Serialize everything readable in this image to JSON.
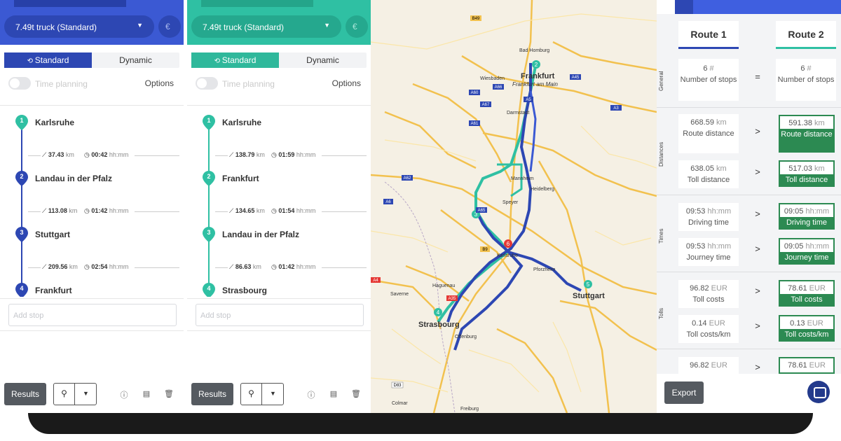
{
  "panels": [
    {
      "vehicle": "7.49t truck (Standard)",
      "currency": "€",
      "mode_tabs": [
        "Standard",
        "Dynamic"
      ],
      "time_planning": "Time planning",
      "options": "Options",
      "stops": [
        {
          "index": "1",
          "name": "Karlsruhe"
        },
        {
          "index": "2",
          "name": "Landau in der Pfalz"
        },
        {
          "index": "3",
          "name": "Stuttgart"
        },
        {
          "index": "4",
          "name": "Frankfurt"
        }
      ],
      "legs": [
        {
          "distance": "37.43",
          "dist_unit": "km",
          "time": "00:42",
          "time_unit": "hh:mm"
        },
        {
          "distance": "113.08",
          "dist_unit": "km",
          "time": "01:42",
          "time_unit": "hh:mm"
        },
        {
          "distance": "209.56",
          "dist_unit": "km",
          "time": "02:54",
          "time_unit": "hh:mm"
        }
      ],
      "add_stop_placeholder": "Add stop",
      "results_label": "Results"
    },
    {
      "vehicle": "7.49t truck (Standard)",
      "currency": "€",
      "mode_tabs": [
        "Standard",
        "Dynamic"
      ],
      "time_planning": "Time planning",
      "options": "Options",
      "stops": [
        {
          "index": "1",
          "name": "Karlsruhe"
        },
        {
          "index": "2",
          "name": "Frankfurt"
        },
        {
          "index": "3",
          "name": "Landau in der Pfalz"
        },
        {
          "index": "4",
          "name": "Strasbourg"
        }
      ],
      "legs": [
        {
          "distance": "138.79",
          "dist_unit": "km",
          "time": "01:59",
          "time_unit": "hh:mm"
        },
        {
          "distance": "134.65",
          "dist_unit": "km",
          "time": "01:54",
          "time_unit": "hh:mm"
        },
        {
          "distance": "86.63",
          "dist_unit": "km",
          "time": "01:42",
          "time_unit": "hh:mm"
        }
      ],
      "add_stop_placeholder": "Add stop",
      "results_label": "Results"
    }
  ],
  "map": {
    "cities": [
      {
        "name": "Frankfurt",
        "sub": "Frankfurt am Main"
      },
      {
        "name": "Stuttgart"
      },
      {
        "name": "Strasbourg"
      },
      {
        "name": "Karlsruhe"
      },
      {
        "name": "Mannheim"
      },
      {
        "name": "Wiesbaden"
      },
      {
        "name": "Darmstadt"
      },
      {
        "name": "Heidelberg"
      },
      {
        "name": "Offenburg"
      },
      {
        "name": "Freiburg"
      },
      {
        "name": "Colmar"
      },
      {
        "name": "Haguenau"
      },
      {
        "name": "Speyer"
      },
      {
        "name": "Bad Homburg"
      },
      {
        "name": "Saverne"
      },
      {
        "name": "Pforzheim"
      }
    ],
    "roads": [
      "B49",
      "A5",
      "A60",
      "A66",
      "A61",
      "A67",
      "A3",
      "A45",
      "A62",
      "A6",
      "B9",
      "A35",
      "A4",
      "D83",
      "A65"
    ],
    "markers": [
      "1",
      "2",
      "3",
      "4",
      "5",
      "6"
    ],
    "colors": {
      "route1": "#2d47b3",
      "route2": "#2fc0a3",
      "marker_end": "#e53935"
    }
  },
  "compare": {
    "headers": [
      "Route 1",
      "Route 2"
    ],
    "sections": [
      "General",
      "Distances",
      "Times",
      "Tolls"
    ],
    "rows": [
      {
        "r1_value": "6",
        "r1_unit": "#",
        "r1_label": "Number of stops",
        "sym": "=",
        "r2_value": "6",
        "r2_unit": "#",
        "r2_label": "Number of stops",
        "winner": ""
      },
      {
        "r1_value": "668.59",
        "r1_unit": "km",
        "r1_label": "Route distance",
        "sym": ">",
        "r2_value": "591.38",
        "r2_unit": "km",
        "r2_label": "Route distance",
        "winner": "r2"
      },
      {
        "r1_value": "638.05",
        "r1_unit": "km",
        "r1_label": "Toll distance",
        "sym": ">",
        "r2_value": "517.03",
        "r2_unit": "km",
        "r2_label": "Toll distance",
        "winner": "r2"
      },
      {
        "r1_value": "09:53",
        "r1_unit": "hh:mm",
        "r1_label": "Driving time",
        "sym": ">",
        "r2_value": "09:05",
        "r2_unit": "hh:mm",
        "r2_label": "Driving time",
        "winner": "r2"
      },
      {
        "r1_value": "09:53",
        "r1_unit": "hh:mm",
        "r1_label": "Journey time",
        "sym": ">",
        "r2_value": "09:05",
        "r2_unit": "hh:mm",
        "r2_label": "Journey time",
        "winner": "r2"
      },
      {
        "r1_value": "96.82",
        "r1_unit": "EUR",
        "r1_label": "Toll costs",
        "sym": ">",
        "r2_value": "78.61",
        "r2_unit": "EUR",
        "r2_label": "Toll costs",
        "winner": "r2"
      },
      {
        "r1_value": "0.14",
        "r1_unit": "EUR",
        "r1_label": "Toll costs/km",
        "sym": ">",
        "r2_value": "0.13",
        "r2_unit": "EUR",
        "r2_label": "Toll costs/km",
        "winner": "r2"
      },
      {
        "r1_value": "96.82",
        "r1_unit": "EUR",
        "r1_label": "",
        "sym": ">",
        "r2_value": "78.61",
        "r2_unit": "EUR",
        "r2_label": "",
        "winner": "r2"
      }
    ],
    "export_label": "Export"
  }
}
